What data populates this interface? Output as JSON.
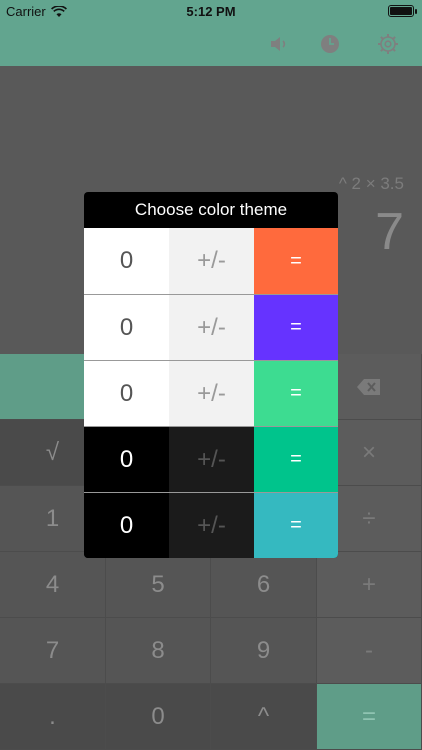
{
  "status": {
    "carrier": "Carrier",
    "time": "5:12 PM",
    "battery_level": 1.0
  },
  "toolbar": {
    "icons": [
      "speaker-icon",
      "history-clock-icon",
      "settings-gear-icon"
    ]
  },
  "display": {
    "expression": "^ 2 × 3.5",
    "result": "7"
  },
  "keypad": {
    "keys": [
      [
        "",
        "",
        "",
        "⌫"
      ],
      [
        "√",
        "",
        "",
        "×"
      ],
      [
        "1",
        "",
        "",
        "÷"
      ],
      [
        "4",
        "5",
        "6",
        "+"
      ],
      [
        "7",
        "8",
        "9",
        "-"
      ],
      [
        ".",
        "0",
        "^",
        "="
      ]
    ]
  },
  "dialog": {
    "title": "Choose color theme",
    "themes": [
      {
        "digit": "0",
        "toggle": "+/-",
        "equals": "=",
        "digit_bg": "#ffffff",
        "digit_fg": "#555555",
        "toggle_bg": "#f2f2f2",
        "toggle_fg": "#9a9a9a",
        "equals_bg": "#ff6a3d"
      },
      {
        "digit": "0",
        "toggle": "+/-",
        "equals": "=",
        "digit_bg": "#ffffff",
        "digit_fg": "#555555",
        "toggle_bg": "#f2f2f2",
        "toggle_fg": "#9a9a9a",
        "equals_bg": "#6633ff"
      },
      {
        "digit": "0",
        "toggle": "+/-",
        "equals": "=",
        "digit_bg": "#ffffff",
        "digit_fg": "#555555",
        "toggle_bg": "#f2f2f2",
        "toggle_fg": "#9a9a9a",
        "equals_bg": "#3ddc91"
      },
      {
        "digit": "0",
        "toggle": "+/-",
        "equals": "=",
        "digit_bg": "#000000",
        "digit_fg": "#ffffff",
        "toggle_bg": "#1b1b1b",
        "toggle_fg": "#555555",
        "equals_bg": "#00c48c"
      },
      {
        "digit": "0",
        "toggle": "+/-",
        "equals": "=",
        "digit_bg": "#000000",
        "digit_fg": "#ffffff",
        "toggle_bg": "#1b1b1b",
        "toggle_fg": "#555555",
        "equals_bg": "#35b9c0"
      }
    ]
  }
}
